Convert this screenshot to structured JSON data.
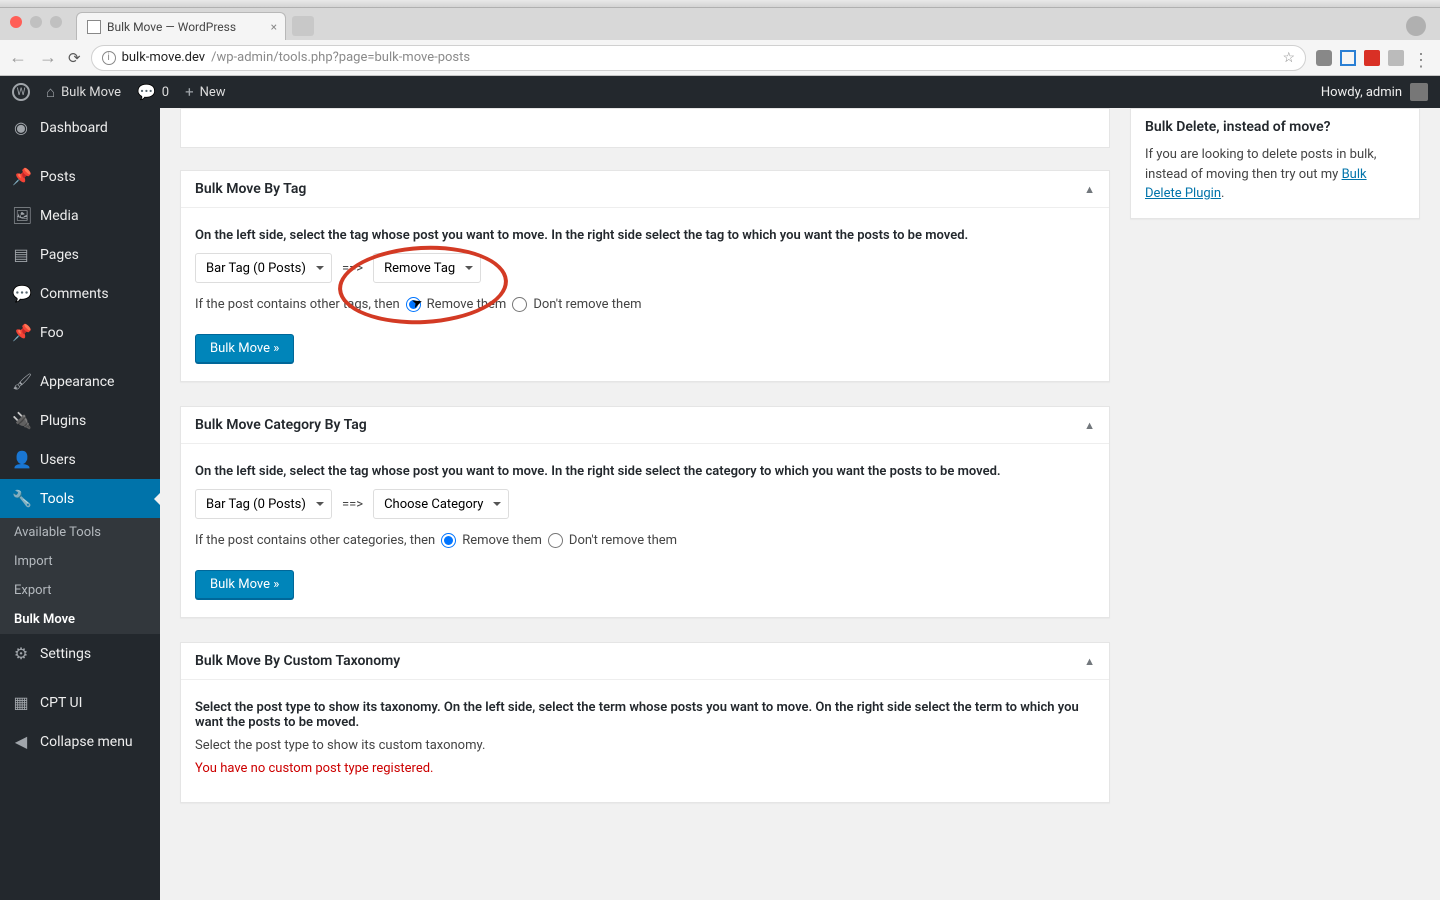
{
  "browser": {
    "tab_title": "Bulk Move — WordPress",
    "url_host": "bulk-move.dev",
    "url_path": "/wp-admin/tools.php?page=bulk-move-posts"
  },
  "wpbar": {
    "site": "Bulk Move",
    "comments": "0",
    "new": "New",
    "howdy": "Howdy, admin"
  },
  "menu": {
    "dashboard": "Dashboard",
    "posts": "Posts",
    "media": "Media",
    "pages": "Pages",
    "comments": "Comments",
    "foo": "Foo",
    "appearance": "Appearance",
    "plugins": "Plugins",
    "users": "Users",
    "tools": "Tools",
    "subs": {
      "available": "Available Tools",
      "import": "Import",
      "export": "Export",
      "bulk": "Bulk Move"
    },
    "settings": "Settings",
    "cpt": "CPT UI",
    "collapse": "Collapse menu"
  },
  "boxes": {
    "byTag": {
      "title": "Bulk Move By Tag",
      "desc": "On the left side, select the tag whose post you want to move. In the right side select the tag to which you want the posts to be moved.",
      "src": "Bar Tag (0 Posts)",
      "dst": "Remove Tag",
      "arrow": "==>",
      "otherPrefix": "If the post contains other tags, then",
      "remove": "Remove them",
      "dont": "Don't remove them",
      "submit": "Bulk Move »"
    },
    "catByTag": {
      "title": "Bulk Move Category By Tag",
      "desc": "On the left side, select the tag whose post you want to move. In the right side select the category to which you want the posts to be moved.",
      "src": "Bar Tag (0 Posts)",
      "dst": "Choose Category",
      "arrow": "==>",
      "otherPrefix": "If the post contains other categories, then",
      "remove": "Remove them",
      "dont": "Don't remove them",
      "submit": "Bulk Move »"
    },
    "customTax": {
      "title": "Bulk Move By Custom Taxonomy",
      "desc": "Select the post type to show its taxonomy. On the left side, select the term whose posts you want to move. On the right side select the term to which you want the posts to be moved.",
      "note": "Select the post type to show its custom taxonomy.",
      "warn": "You have no custom post type registered."
    }
  },
  "sidebox": {
    "title": "Bulk Delete, instead of move?",
    "body1": "If you are looking to delete posts in bulk, instead of moving then try out my ",
    "link": "Bulk Delete Plugin",
    "body2": "."
  }
}
